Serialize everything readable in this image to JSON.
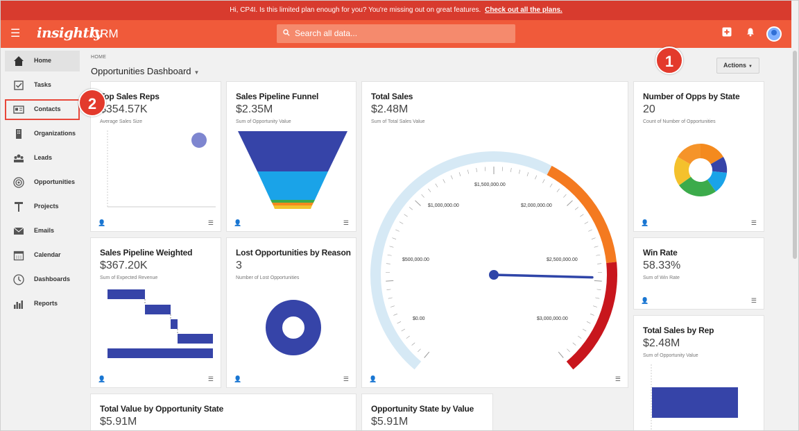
{
  "banner": {
    "message": "Hi, CP4I. Is this limited plan enough for you? You're missing out on great features.",
    "link": "Check out all the plans."
  },
  "header": {
    "logo": "insightly",
    "product": "CRM",
    "search_placeholder": "Search all data...",
    "icons": [
      "menu-icon",
      "search-icon",
      "add-icon",
      "bell-icon",
      "avatar"
    ]
  },
  "sidebar": {
    "items": [
      {
        "label": "Home",
        "icon": "home-icon",
        "active": true
      },
      {
        "label": "Tasks",
        "icon": "tasks-icon"
      },
      {
        "label": "Contacts",
        "icon": "contacts-icon",
        "highlighted": true
      },
      {
        "label": "Organizations",
        "icon": "organizations-icon"
      },
      {
        "label": "Leads",
        "icon": "leads-icon"
      },
      {
        "label": "Opportunities",
        "icon": "opportunities-icon"
      },
      {
        "label": "Projects",
        "icon": "projects-icon"
      },
      {
        "label": "Emails",
        "icon": "emails-icon"
      },
      {
        "label": "Calendar",
        "icon": "calendar-icon"
      },
      {
        "label": "Dashboards",
        "icon": "dashboards-icon"
      },
      {
        "label": "Reports",
        "icon": "reports-icon"
      }
    ]
  },
  "page": {
    "breadcrumb": "HOME",
    "title": "Opportunities Dashboard",
    "actions_label": "Actions"
  },
  "callouts": {
    "one": "1",
    "two": "2"
  },
  "cards": {
    "top_sales_reps": {
      "title": "Top Sales Reps",
      "value": "$354.57K",
      "sub": "Average Sales Size"
    },
    "pipeline_funnel": {
      "title": "Sales Pipeline Funnel",
      "value": "$2.35M",
      "sub": "Sum of Opportunity Value"
    },
    "total_sales": {
      "title": "Total Sales",
      "value": "$2.48M",
      "sub": "Sum of Total Sales Value"
    },
    "opps_by_state": {
      "title": "Number of Opps by State",
      "value": "20",
      "sub": "Count of Number of Opportunities"
    },
    "pipeline_weighted": {
      "title": "Sales Pipeline Weighted",
      "value": "$367.20K",
      "sub": "Sum of Expected Revenue"
    },
    "lost_opps": {
      "title": "Lost Opportunities by Reason",
      "value": "3",
      "sub": "Number of Lost Opportunities"
    },
    "win_rate": {
      "title": "Win Rate",
      "value": "58.33%",
      "sub": "Sum of Win Rate"
    },
    "total_sales_by_rep": {
      "title": "Total Sales by Rep",
      "value": "$2.48M",
      "sub": "Sum of Opportunity Value"
    },
    "total_value_by_state": {
      "title": "Total Value by Opportunity State",
      "value": "$5.91M",
      "sub": ""
    },
    "opp_state_by_value": {
      "title": "Opportunity State by Value",
      "value": "$5.91M",
      "sub": ""
    }
  },
  "gauge": {
    "labels": [
      "$0.00",
      "$500,000.00",
      "$1,000,000.00",
      "$1,500,000.00",
      "$2,000,000.00",
      "$2,500,000.00",
      "$3,000,000.00"
    ],
    "min": 0,
    "max": 3000000,
    "value": 2480000,
    "colors": {
      "base": "#d6e9f5",
      "warn": "#f47a20",
      "danger": "#c8161d",
      "needle": "#2f45a8"
    }
  },
  "colors": {
    "banner": "#d83b2e",
    "header": "#f05a3a",
    "navy": "#3644a8",
    "sky": "#1aa3e8",
    "green": "#3cab4b",
    "yellow": "#f4c12c",
    "orange": "#f48a1e",
    "purple": "#7e86d0"
  }
}
